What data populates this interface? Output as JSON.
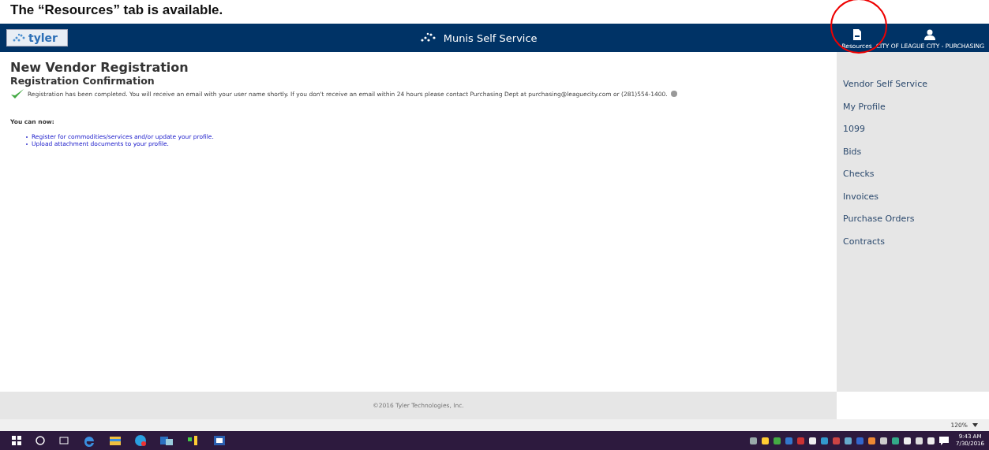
{
  "caption": "The “Resources” tab is available.",
  "header": {
    "logo": "tyler",
    "title": "Munis Self Service",
    "resources": "Resources",
    "user": "CITY OF LEAGUE CITY - PURCHASING"
  },
  "page": {
    "title": "New Vendor Registration",
    "subtitle": "Registration Confirmation",
    "message": "Registration has been completed. You will receive an email with your user name shortly. If you don't receive an email within 24 hours please contact Purchasing Dept at purchasing@leaguecity.com or (281)554-1400.",
    "intro": "You can now:",
    "links": [
      "Register for commodities/services and/or update your profile.",
      "Upload attachment documents to your profile."
    ]
  },
  "sidebar": {
    "items": [
      {
        "label": "Vendor Self Service"
      },
      {
        "label": "My Profile"
      },
      {
        "label": "1099"
      },
      {
        "label": "Bids"
      },
      {
        "label": "Checks"
      },
      {
        "label": "Invoices"
      },
      {
        "label": "Purchase Orders"
      },
      {
        "label": "Contracts"
      }
    ]
  },
  "footer": "©2016 Tyler Technologies, Inc.",
  "zoom": "120%",
  "taskbar": {
    "time": "9:43 AM",
    "date": "7/30/2016"
  }
}
